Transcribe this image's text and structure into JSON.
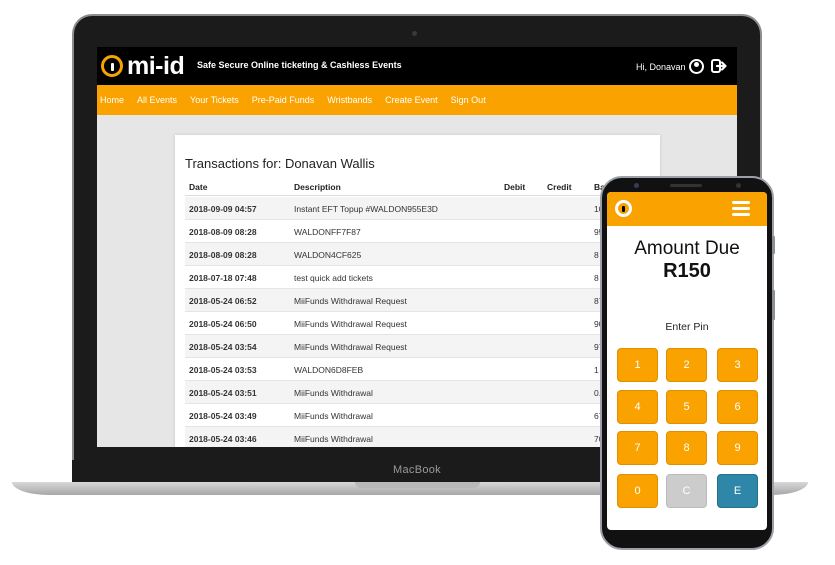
{
  "laptop": {
    "brand": "MacBook"
  },
  "site": {
    "logo_text": "mi-id",
    "tagline": "Safe Secure Online ticketing & Cashless Events",
    "greeting": "Hi, Donavan",
    "nav": [
      "Home",
      "All Events",
      "Your Tickets",
      "Pre-Paid Funds",
      "Wristbands",
      "Create Event",
      "Sign Out"
    ],
    "colors": {
      "brand_orange": "#f9a200",
      "header_black": "#000000",
      "enter_blue": "#2e86a8"
    }
  },
  "transactions": {
    "title": "Transactions for: Donavan Wallis",
    "columns": [
      "Date",
      "Description",
      "Debit",
      "Credit",
      "Ba"
    ],
    "rows": [
      {
        "date": "2018-09-09 04:57",
        "description": "Instant EFT Topup #WALDON955E3D",
        "debit": "",
        "credit": "",
        "balance": "10"
      },
      {
        "date": "2018-08-09 08:28",
        "description": "WALDONFF7F87",
        "debit": "",
        "credit": "",
        "balance": "95"
      },
      {
        "date": "2018-08-09 08:28",
        "description": "WALDON4CF625",
        "debit": "",
        "credit": "",
        "balance": "8"
      },
      {
        "date": "2018-07-18 07:48",
        "description": "test quick add tickets",
        "debit": "",
        "credit": "",
        "balance": "8"
      },
      {
        "date": "2018-05-24 06:52",
        "description": "MiiFunds Withdrawal Request",
        "debit": "",
        "credit": "",
        "balance": "87"
      },
      {
        "date": "2018-05-24 06:50",
        "description": "MiiFunds Withdrawal Request",
        "debit": "",
        "credit": "",
        "balance": "90"
      },
      {
        "date": "2018-05-24 03:54",
        "description": "MiiFunds Withdrawal Request",
        "debit": "",
        "credit": "",
        "balance": "97"
      },
      {
        "date": "2018-05-24 03:53",
        "description": "WALDON6D8FEB",
        "debit": "",
        "credit": "",
        "balance": "1"
      },
      {
        "date": "2018-05-24 03:51",
        "description": "MiiFunds Withdrawal",
        "debit": "",
        "credit": "",
        "balance": "0."
      },
      {
        "date": "2018-05-24 03:49",
        "description": "MiiFunds Withdrawal",
        "debit": "",
        "credit": "",
        "balance": "67"
      },
      {
        "date": "2018-05-24 03:46",
        "description": "MiiFunds Withdrawal",
        "debit": "",
        "credit": "",
        "balance": "70"
      }
    ]
  },
  "phone": {
    "amount_label": "Amount Due",
    "amount_value": "R150",
    "pin_label": "Enter Pin",
    "keys": [
      "1",
      "2",
      "3",
      "4",
      "5",
      "6",
      "7",
      "8",
      "9",
      "0",
      "C",
      "E"
    ]
  }
}
